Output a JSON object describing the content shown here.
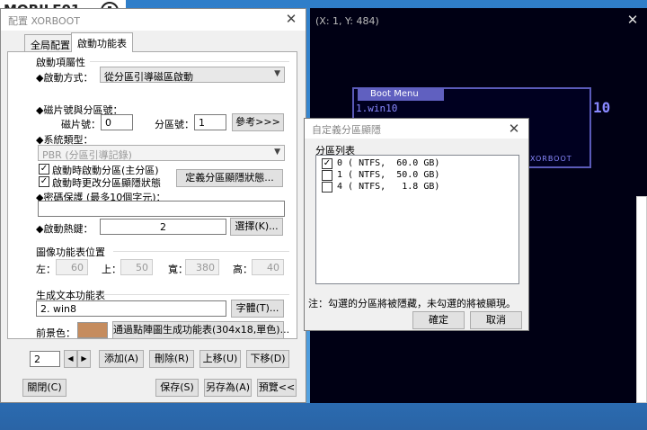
{
  "logo": {
    "text": "MOBILE01"
  },
  "main_window": {
    "title": "配置 XORBOOT",
    "tabs": [
      {
        "label": "全局配置"
      },
      {
        "label": "啟動功能表"
      }
    ],
    "boot_props": {
      "title": "啟動項屬性",
      "boot_mode_label": "◆啟動方式：",
      "boot_mode_value": "從分區引導磁區啟動",
      "disk_part_label": "◆磁片號與分區號：",
      "disk_no_label": "磁片號：",
      "disk_no_value": "0",
      "part_no_label": "分區號：",
      "part_no_value": "1",
      "ref_button": "參考>>>",
      "sys_type_label": "◆系統類型：",
      "sys_type_value": "PBR (分區引導記錄)",
      "chk_active_label": "啟動時啟動分區(主分區)",
      "chk_hidden_label": "啟動時更改分區顯隱狀態",
      "define_hidden_button": "定義分區顯隱狀態...",
      "password_label": "◆密碼保護 (最多10個字元)：",
      "password_value": "",
      "hotkey_label": "◆啟動熱鍵：",
      "hotkey_value": "2",
      "hotkey_button": "選擇(K)..."
    },
    "image_menu": {
      "title": "圖像功能表位置",
      "left_label": "左：",
      "left_value": "60",
      "top_label": "上：",
      "top_value": "50",
      "width_label": "寬：",
      "width_value": "380",
      "height_label": "高：",
      "height_value": "40"
    },
    "text_menu": {
      "title": "生成文本功能表",
      "text_value": "2. win8",
      "font_button": "字體(T)...",
      "fg_label": "前景色：",
      "dot_button": "通過點陣圖生成功能表(304x18,單色)..."
    },
    "bottom_row": {
      "index_value": "2",
      "prev_icon": "left-triangle",
      "next_icon": "right-triangle",
      "add_button": "添加(A)",
      "delete_button": "刪除(R)",
      "up_button": "上移(U)",
      "down_button": "下移(D)"
    },
    "footer": {
      "close_button": "關閉(C)",
      "save_button": "保存(S)",
      "saveas_button": "另存為(A)",
      "preview_button": "預覽<<"
    }
  },
  "preview_window": {
    "title": "(X: 1, Y: 484)",
    "menu_title": "Boot Menu",
    "menu_item": "1.win10",
    "countdown": "10",
    "brand": "XORBOOT"
  },
  "dialog": {
    "title": "自定義分區顯隱",
    "list_title": "分區列表",
    "rows": [
      {
        "checked": true,
        "text": "0 ( NTFS,  60.0 GB)"
      },
      {
        "checked": false,
        "text": "1 ( NTFS,  50.0 GB)"
      },
      {
        "checked": false,
        "text": "4 ( NTFS,   1.8 GB)"
      }
    ],
    "note": "注：勾選的分區將被隱藏，未勾選的將被顯現。",
    "ok_button": "確定",
    "cancel_button": "取消"
  }
}
